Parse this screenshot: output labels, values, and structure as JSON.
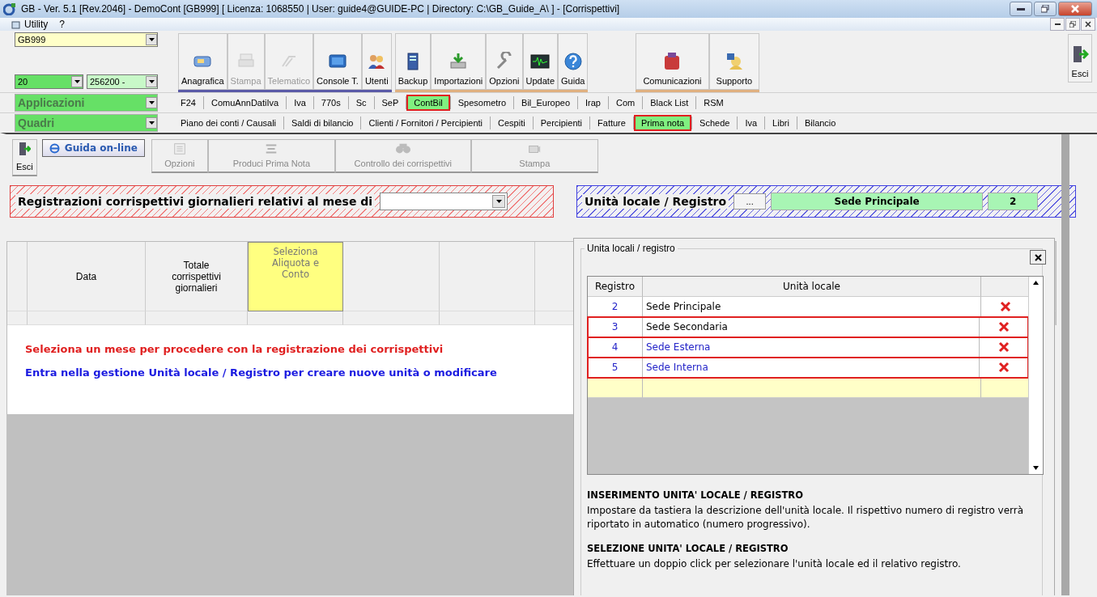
{
  "window": {
    "title": "GB - Ver. 5.1 [Rev.2046] -  DemoCont [GB999]    [ Licenza: 1068550 | User: guide4@GUIDE-PC | Directory: C:\\GB_Guide_A\\ ] - [Corrispettivi]"
  },
  "menu": [
    "Utility",
    "?"
  ],
  "selectors": {
    "company": "GB999",
    "year": "20",
    "code": "256200 -"
  },
  "toolbar_groups": [
    {
      "buttons": [
        {
          "label": "Anagrafica",
          "disabled": false
        },
        {
          "label": "Stampa",
          "disabled": true
        },
        {
          "label": "Telematico",
          "disabled": true
        },
        {
          "label": "Console T.",
          "disabled": false
        },
        {
          "label": "Utenti",
          "disabled": false
        }
      ]
    },
    {
      "buttons": [
        {
          "label": "Backup",
          "disabled": false
        },
        {
          "label": "Importazioni",
          "disabled": false
        },
        {
          "label": "Opzioni",
          "disabled": false
        },
        {
          "label": "Update",
          "disabled": false
        },
        {
          "label": "Guida",
          "disabled": false
        }
      ]
    },
    {
      "buttons": [
        {
          "label": "Comunicazioni",
          "disabled": false
        },
        {
          "label": "Supporto",
          "disabled": false
        }
      ]
    }
  ],
  "exit_button": "Esci",
  "applicazioni": {
    "label": "Applicazioni",
    "tabs": [
      {
        "label": "F24",
        "selected": false
      },
      {
        "label": "ComuAnnDatiIva",
        "selected": false
      },
      {
        "label": "Iva",
        "selected": false
      },
      {
        "label": "770s",
        "selected": false
      },
      {
        "label": "Sc",
        "selected": false
      },
      {
        "label": "SeP",
        "selected": false
      },
      {
        "label": "ContBil",
        "selected": true
      },
      {
        "label": "Spesometro",
        "selected": false
      },
      {
        "label": "Bil_Europeo",
        "selected": false
      },
      {
        "label": "Irap",
        "selected": false
      },
      {
        "label": "Com",
        "selected": false
      },
      {
        "label": "Black List",
        "selected": false
      },
      {
        "label": "RSM",
        "selected": false
      }
    ]
  },
  "quadri": {
    "label": "Quadri",
    "tabs": [
      {
        "label": "Piano dei conti / Causali",
        "selected": false
      },
      {
        "label": "Saldi di bilancio",
        "selected": false
      },
      {
        "label": "Clienti / Fornitori / Percipienti",
        "selected": false
      },
      {
        "label": "Cespiti",
        "selected": false
      },
      {
        "label": "Percipienti",
        "selected": false
      },
      {
        "label": "Fatture",
        "selected": false
      },
      {
        "label": "Prima nota",
        "selected": true
      },
      {
        "label": "Schede",
        "selected": false
      },
      {
        "label": "Iva",
        "selected": false
      },
      {
        "label": "Libri",
        "selected": false
      },
      {
        "label": "Bilancio",
        "selected": false
      }
    ]
  },
  "form_toolbar": {
    "exit": "Esci",
    "help": "Guida on-line",
    "buttons": [
      {
        "label": "Opzioni",
        "disabled": true
      },
      {
        "label": "Produci  Prima Nota",
        "disabled": true
      },
      {
        "label": "Controllo dei corrispettivi",
        "disabled": true
      },
      {
        "label": "Stampa",
        "disabled": true
      }
    ]
  },
  "month_banner": {
    "label": "Registrazioni corrispettivi giornalieri relativi al mese di"
  },
  "unit_banner": {
    "label": "Unità locale / Registro",
    "button": "...",
    "unit": "Sede Principale",
    "register": "2"
  },
  "grid": {
    "columns": [
      "Data",
      "Totale corrispettivi giornalieri",
      "Seleziona Aliquota e Conto"
    ]
  },
  "messages": [
    {
      "text": "Seleziona un mese per procedere con la registrazione dei corrispettivi",
      "kind": "warning"
    },
    {
      "text": "Entra nella gestione Unità locale / Registro per creare nuove unità o modificare",
      "kind": "info"
    }
  ],
  "popup": {
    "title": "Unita locali / registro",
    "columns": [
      "Registro",
      "Unità locale"
    ],
    "rows": [
      {
        "register": "2",
        "unit": "Sede Principale",
        "color": "#000000",
        "highlighted": false
      },
      {
        "register": "3",
        "unit": "Sede Secondaria",
        "color": "#000000",
        "highlighted": true
      },
      {
        "register": "4",
        "unit": "Sede Esterna",
        "color": "#2424c8",
        "highlighted": true
      },
      {
        "register": "5",
        "unit": "Sede Interna",
        "color": "#2424c8",
        "highlighted": true
      }
    ],
    "help": [
      {
        "heading": "INSERIMENTO UNITA' LOCALE / REGISTRO",
        "text": "Impostare da tastiera la descrizione dell'unità locale. Il rispettivo numero di registro verrà riportato in automatico (numero progressivo)."
      },
      {
        "heading": "SELEZIONE UNITA' LOCALE / REGISTRO",
        "text": "Effettuare un doppio click per selezionare l'unità locale ed il relativo registro."
      }
    ]
  }
}
